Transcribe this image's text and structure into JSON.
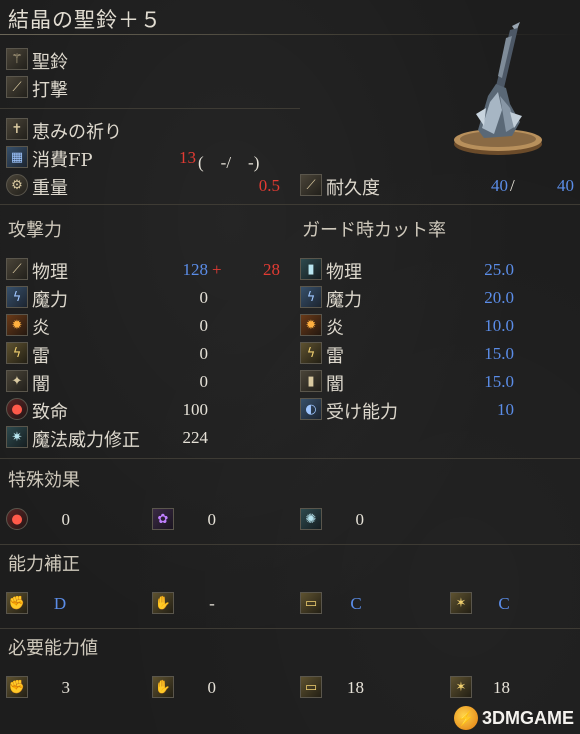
{
  "title": "結晶の聖鈴＋５",
  "weapon": {
    "type": "聖鈴",
    "attack_type": "打撃",
    "skill": "恵みの祈り",
    "fp_label": "消費FP",
    "fp_value": "13",
    "fp_paren": "(　-/　-)",
    "weight_label": "重量",
    "weight_value": "0.5",
    "durability_label": "耐久度",
    "durability_current": "40",
    "durability_sep": "/",
    "durability_max": "40"
  },
  "attack": {
    "header": "攻撃力",
    "rows": [
      {
        "label": "物理",
        "value": "128",
        "plus": "+",
        "bonus": "28",
        "icon": "physical-icon"
      },
      {
        "label": "魔力",
        "value": "0",
        "icon": "magic-icon"
      },
      {
        "label": "炎",
        "value": "0",
        "icon": "fire-icon"
      },
      {
        "label": "雷",
        "value": "0",
        "icon": "lightning-icon"
      },
      {
        "label": "闇",
        "value": "0",
        "icon": "dark-icon"
      },
      {
        "label": "致命",
        "value": "100",
        "icon": "critical-icon"
      },
      {
        "label": "魔法威力修正",
        "value": "224",
        "icon": "spell-buff-icon"
      }
    ]
  },
  "guard": {
    "header": "ガード時カット率",
    "rows": [
      {
        "label": "物理",
        "value": "25.0",
        "icon": "guard-physical-icon"
      },
      {
        "label": "魔力",
        "value": "20.0",
        "icon": "guard-magic-icon"
      },
      {
        "label": "炎",
        "value": "10.0",
        "icon": "guard-fire-icon"
      },
      {
        "label": "雷",
        "value": "15.0",
        "icon": "guard-lightning-icon"
      },
      {
        "label": "闇",
        "value": "15.0",
        "icon": "guard-dark-icon"
      },
      {
        "label": "受け能力",
        "value": "10",
        "icon": "stability-icon"
      }
    ]
  },
  "special": {
    "header": "特殊効果",
    "items": [
      {
        "icon": "bleed-icon",
        "value": "0"
      },
      {
        "icon": "poison-icon",
        "value": "0"
      },
      {
        "icon": "frost-icon",
        "value": "0"
      }
    ]
  },
  "scaling": {
    "header": "能力補正",
    "items": [
      {
        "icon": "strength-icon",
        "value": "D"
      },
      {
        "icon": "dexterity-icon",
        "value": "-"
      },
      {
        "icon": "intelligence-icon",
        "value": "C"
      },
      {
        "icon": "faith-icon",
        "value": "C"
      }
    ]
  },
  "requirements": {
    "header": "必要能力値",
    "items": [
      {
        "icon": "strength-icon",
        "value": "3"
      },
      {
        "icon": "dexterity-icon",
        "value": "0"
      },
      {
        "icon": "intelligence-icon",
        "value": "18"
      },
      {
        "icon": "faith-icon",
        "value": "18"
      }
    ]
  },
  "watermark": {
    "badge": "⚡",
    "text": "3DMGAME"
  }
}
